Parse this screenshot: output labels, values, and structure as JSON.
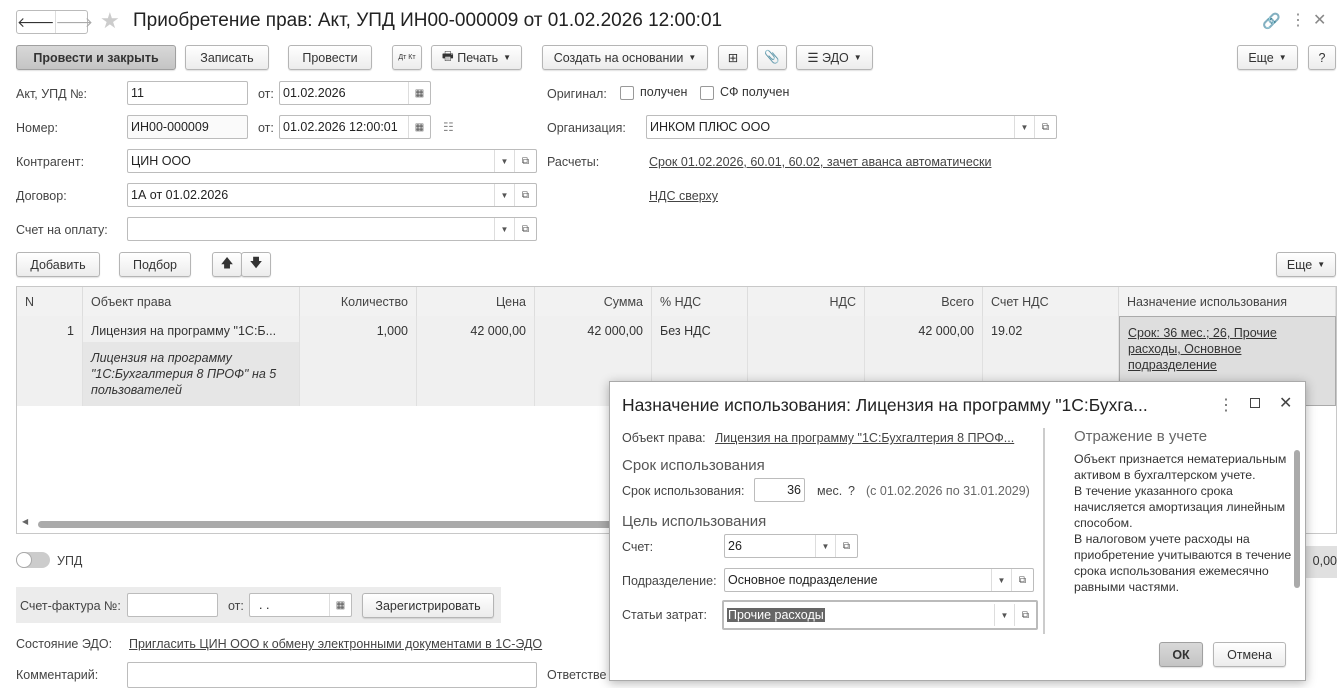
{
  "header": {
    "title": "Приобретение прав: Акт, УПД ИН00-000009 от 01.02.2026 12:00:01"
  },
  "toolbar": {
    "post_close": "Провести и закрыть",
    "save": "Записать",
    "post": "Провести",
    "dtkt": "Дт Кт",
    "print": "Печать",
    "create_based": "Создать на основании",
    "edo": "ЭДО",
    "more": "Еще",
    "help": "?"
  },
  "form": {
    "act_label": "Акт, УПД №:",
    "act_value": "11",
    "from_label": "от:",
    "act_date": "01.02.2026",
    "number_label": "Номер:",
    "number_value": "ИН00-000009",
    "number_date": "01.02.2026 12:00:01",
    "counterparty_label": "Контрагент:",
    "counterparty_value": "ЦИН ООО",
    "contract_label": "Договор:",
    "contract_value": "1А от 01.02.2026",
    "invoice_label": "Счет на оплату:",
    "invoice_value": "",
    "original_label": "Оригинал:",
    "received": "получен",
    "sf_received": "СФ получен",
    "org_label": "Организация:",
    "org_value": "ИНКОМ ПЛЮС ООО",
    "settlements_label": "Расчеты:",
    "settlements_link": "Срок 01.02.2026, 60.01, 60.02, зачет аванса автоматически",
    "vat_link": "НДС сверху"
  },
  "table_toolbar": {
    "add": "Добавить",
    "pick": "Подбор",
    "more": "Еще"
  },
  "table": {
    "columns": [
      "N",
      "Объект права",
      "Количество",
      "Цена",
      "Сумма",
      "% НДС",
      "НДС",
      "Всего",
      "Счет НДС",
      "Назначение использования"
    ],
    "rows": [
      {
        "n": "1",
        "object": "Лицензия на программу \"1С:Б...",
        "object_full": "Лицензия на программу \"1С:Бухгалтерия 8 ПРОФ\" на 5 пользователей",
        "qty": "1,000",
        "price": "42 000,00",
        "sum": "42 000,00",
        "vat_rate": "Без НДС",
        "vat": "",
        "total": "42 000,00",
        "vat_account": "19.02",
        "purpose": "Срок: 36 мес.; 26, Прочие расходы, Основное подразделение"
      }
    ]
  },
  "footer": {
    "upd_label": "УПД",
    "total_partial": "0,00",
    "sf_label": "Счет-фактура №:",
    "sf_value": "",
    "sf_from": "от:",
    "sf_date": " .  . ",
    "register": "Зарегистрировать",
    "edo_label": "Состояние ЭДО:",
    "edo_link": "Пригласить ЦИН ООО к обмену электронными документами в 1С-ЭДО",
    "comment_label": "Комментарий:",
    "responsible_label": "Ответстве"
  },
  "dialog": {
    "title": "Назначение использования: Лицензия на программу \"1С:Бухга...",
    "object_label": "Объект права:",
    "object_link": "Лицензия на программу \"1С:Бухгалтерия 8 ПРОФ...",
    "term_header": "Срок использования",
    "term_label": "Срок использования:",
    "term_value": "36",
    "months": "мес.",
    "help": "?",
    "period": "(с 01.02.2026 по 31.01.2029)",
    "purpose_header": "Цель использования",
    "account_label": "Счет:",
    "account_value": "26",
    "dept_label": "Подразделение:",
    "dept_value": "Основное подразделение",
    "cost_label": "Статьи затрат:",
    "cost_value": "Прочие расходы",
    "reflection_header": "Отражение в учете",
    "reflection_text": "Объект признается нематериальным активом в бухгалтерском учете.\nВ течение указанного срока начисляется амортизация линейным способом.\nВ налоговом учете расходы на приобретение учитываются в течение срока использования ежемесячно равными частями.",
    "ok": "ОК",
    "cancel": "Отмена"
  }
}
